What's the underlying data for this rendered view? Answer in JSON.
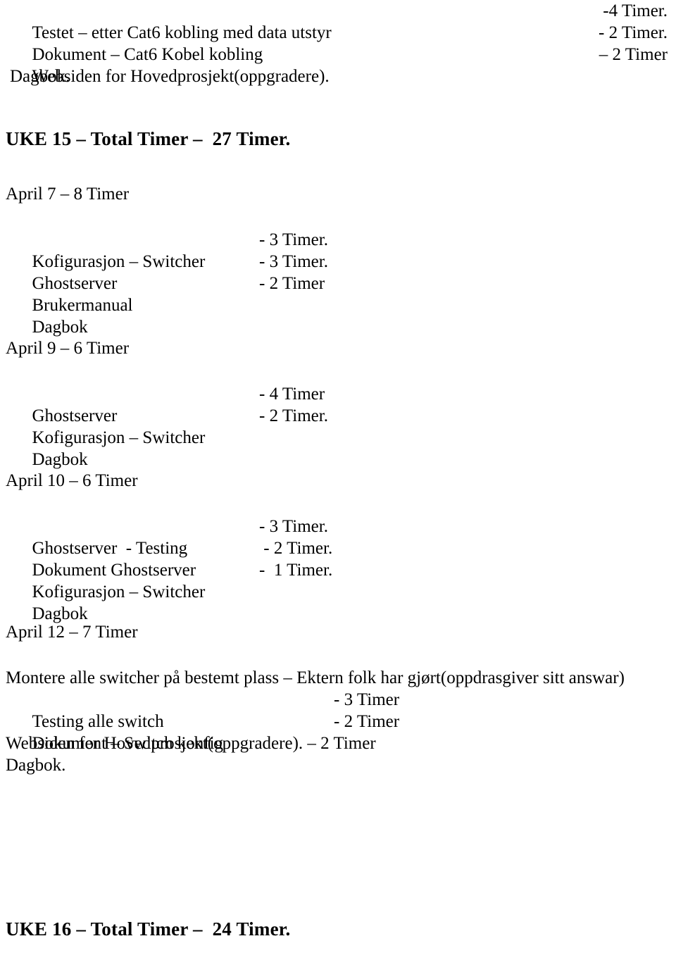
{
  "document": {
    "top_block": {
      "rows": [
        {
          "label": "Testet – etter Cat6 kobling med data utstyr",
          "hours": "-4 Timer."
        },
        {
          "label": "Dokument – Cat6 Kobel kobling",
          "hours": "- 2 Timer."
        },
        {
          "label": "Websiden for Hovedprosjekt(oppgradere).",
          "hours": "– 2 Timer"
        }
      ],
      "footer": "Dagbok."
    },
    "week_15": {
      "heading": "UKE 15 – Total Timer –  27 Timer.",
      "days": [
        {
          "heading": "April 7 – 8 Timer",
          "rows": [
            {
              "label": "Kofigurasjon – Switcher",
              "hours": "- 3 Timer."
            },
            {
              "label": "Ghostserver",
              "hours": "- 3 Timer."
            },
            {
              "label": "Brukermanual",
              "hours": "- 2 Timer"
            }
          ],
          "footer": "Dagbok"
        },
        {
          "heading": "April 9 – 6 Timer",
          "rows": [
            {
              "label": "Ghostserver",
              "hours": "- 4 Timer"
            },
            {
              "label": "Kofigurasjon – Switcher",
              "hours": "- 2 Timer."
            }
          ],
          "footer": "Dagbok"
        },
        {
          "heading": "April 10 – 6 Timer",
          "rows": [
            {
              "label": "Ghostserver  - Testing",
              "hours": "- 3 Timer."
            },
            {
              "label": "Dokument Ghostserver",
              "hours": " - 2 Timer."
            },
            {
              "label": "Kofigurasjon – Switcher",
              "hours": "-  1 Timer."
            }
          ],
          "footer": "Dagbok"
        }
      ]
    },
    "april_12": {
      "heading": "April 12 – 7 Timer",
      "note_line": "Montere alle switcher på bestemt plass – Ektern folk har gjørt(oppdrasgiver sitt answar)",
      "rows": [
        {
          "label": "Testing alle switch",
          "hours": "- 3 Timer"
        },
        {
          "label": "Dokument – Switch konfig",
          "hours": "- 2 Timer"
        }
      ],
      "websiden_line": "Websiden for Hovedprosjekt(oppgradere). – 2 Timer",
      "footer": "Dagbok."
    },
    "week_16": {
      "heading": "UKE 16 – Total Timer –  24 Timer."
    }
  }
}
